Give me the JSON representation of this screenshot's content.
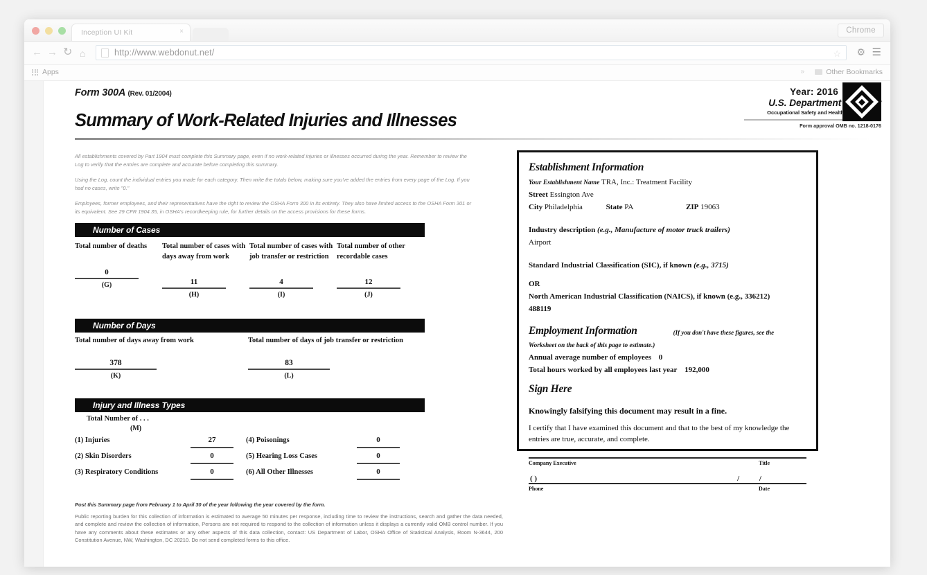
{
  "browser": {
    "tab_title": "Inception UI Kit",
    "tab_close": "×",
    "chrome_badge": "Chrome",
    "url": "http://www.webdonut.net/",
    "back_icon": "←",
    "forward_icon": "→",
    "reload_icon": "↻",
    "home_icon": "⌂",
    "star_icon": "☆",
    "settings_icon": "⚙",
    "menu_icon": "☰",
    "apps_label": "Apps",
    "overflow_label": "»",
    "other_bookmarks_label": "Other Bookmarks"
  },
  "form": {
    "form_number": "Form 300A",
    "revision": "(Rev. 01/2004)",
    "title": "Summary of Work-Related Injuries and Illnesses",
    "year_label": "Year:",
    "year_value": "2016",
    "agency": "U.S. Department of Labor",
    "agency_sub": "Occupational Safety and Health Administration",
    "omb": "Form approval OMB no. 1218-0176",
    "intro": [
      "All establishments covered by Part 1904 must complete this Summary page, even if no work-related injuries or illnesses occurred during the year.  Remember to review the Log to verify that the entries are complete and accurate before completing this summary.",
      "Using the Log, count the individual entries you made for each category. Then write the totals below, making sure you've added the entries from every page of the Log. If you had no cases, write \"0.\"",
      "Employees, former employees, and their representatives have the right to review the OSHA Form 300 in its entirety. They also have limited access to the OSHA Form 301 or its equivalent. See 29 CFR 1904.35, in OSHA's recordkeeping rule, for further details on the access provisions for these forms."
    ],
    "cases": {
      "section_title": "Number of Cases",
      "items": [
        {
          "label": "Total number of deaths",
          "value": "0",
          "key": "(G)"
        },
        {
          "label": "Total number of cases with days away from work",
          "value": "11",
          "key": "(H)"
        },
        {
          "label": "Total number of cases with job transfer or restriction",
          "value": "4",
          "key": "(I)"
        },
        {
          "label": "Total number of other recordable cases",
          "value": "12",
          "key": "(J)"
        }
      ]
    },
    "days": {
      "section_title": "Number of Days",
      "items": [
        {
          "label": "Total number of days away from work",
          "value": "378",
          "key": "(K)"
        },
        {
          "label": "Total number of days of job transfer or restriction",
          "value": "83",
          "key": "(L)"
        }
      ]
    },
    "types": {
      "section_title": "Injury and Illness Types",
      "total_label": "Total Number of  . . .",
      "total_key": "(M)",
      "left": [
        {
          "label": "(1) Injuries",
          "value": "27"
        },
        {
          "label": "(2) Skin Disorders",
          "value": "0"
        },
        {
          "label": "(3) Respiratory Conditions",
          "value": "0"
        }
      ],
      "right": [
        {
          "label": "(4) Poisonings",
          "value": "0"
        },
        {
          "label": "(5) Hearing Loss Cases",
          "value": "0"
        },
        {
          "label": "(6) All Other Illnesses",
          "value": "0"
        }
      ]
    },
    "footer_head": "Post this Summary page from February 1 to April 30 of the year following the year covered by the form.",
    "footer_body": "Public reporting burden for this collection of information is estimated to average 50 minutes per response, including time to review the instructions, search and gather the data needed, and complete and review the collection of information, Persons are not required to respond to the collection of information unless it displays a currently valid OMB control number. If you have any comments about these estimates or any other aspects of this data collection, contact: US Department of Labor, OSHA Office of Statistical Analysis, Room N-3644, 200 Constitution Avenue, NW, Washington, DC 20210. Do not send completed forms to this office."
  },
  "establishment": {
    "heading": "Establishment Information",
    "name_label": "Your Establishment Name",
    "name_value": "TRA, Inc.: Treatment Facility",
    "street_label": "Street",
    "street_value": "Essington Ave",
    "city_label": "City",
    "city_value": "Philadelphia",
    "state_label": "State",
    "state_value": "PA",
    "zip_label": "ZIP",
    "zip_value": "19063",
    "industry_label": "Industry description",
    "industry_example": "(e.g., Manufacture of motor truck trailers)",
    "industry_value": "Airport",
    "sic_label": "Standard Industrial Classification (SIC), if known",
    "sic_example": "(e.g., 3715)",
    "or_label": "OR",
    "naics_label": "North American Industrial Classification (NAICS), if known (e.g., 336212)",
    "naics_value": "488119"
  },
  "employment": {
    "heading": "Employment Information",
    "note_1": "(If you don't have these figures, see the",
    "note_2": "Worksheet on the back of this page to estimate.)",
    "avg_label": "Annual average number of employees",
    "avg_value": "0",
    "hours_label": "Total hours worked by all employees last year",
    "hours_value": "192,000"
  },
  "sign": {
    "heading": "Sign Here",
    "warning": "Knowingly falsifying this document may result in a fine.",
    "certify": "I certify that I have examined this document and that to the best of my knowledge the entries are true, accurate, and complete.",
    "exec_label": "Company Executive",
    "title_label": "Title",
    "phone_prefill": "(         )",
    "date_prefill": "/    /",
    "phone_label": "Phone",
    "date_label": "Date"
  }
}
